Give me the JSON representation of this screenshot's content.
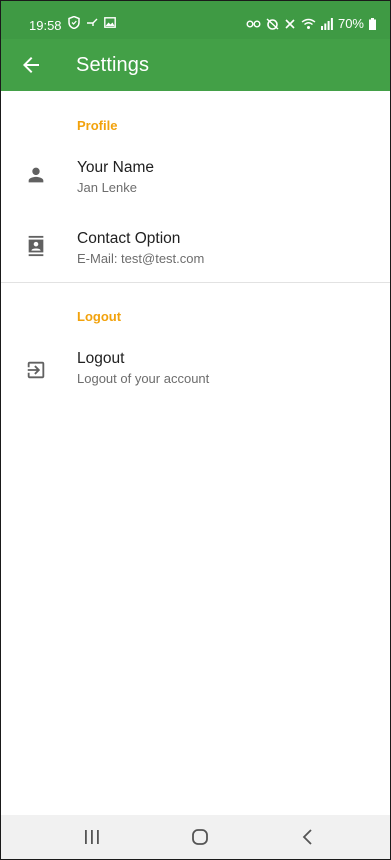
{
  "status_bar": {
    "time": "19:58",
    "battery": "70%",
    "left_icons": [
      "shield-icon",
      "key-icon",
      "image-icon"
    ],
    "right_icons": [
      "vpn-key-icon",
      "alarm-icon",
      "mute-icon",
      "wifi-icon",
      "signal-icon",
      "battery-icon"
    ]
  },
  "app_bar": {
    "title": "Settings",
    "back_icon": "arrow-back-icon",
    "background": "#43a047"
  },
  "sections": {
    "profile": {
      "header": "Profile",
      "items": [
        {
          "icon": "person-icon",
          "title": "Your Name",
          "summary": "Jan Lenke"
        },
        {
          "icon": "contact-card-icon",
          "title": "Contact Option",
          "summary": "E-Mail: test@test.com"
        }
      ]
    },
    "logout": {
      "header": "Logout",
      "items": [
        {
          "icon": "logout-icon",
          "title": "Logout",
          "summary": "Logout of your account"
        }
      ]
    }
  },
  "nav_bar": {
    "buttons": [
      "recent-apps-icon",
      "home-icon",
      "back-icon"
    ]
  },
  "colors": {
    "accent": "#f2a20c",
    "primary": "#43a047",
    "status_bar": "#3f9a44"
  }
}
